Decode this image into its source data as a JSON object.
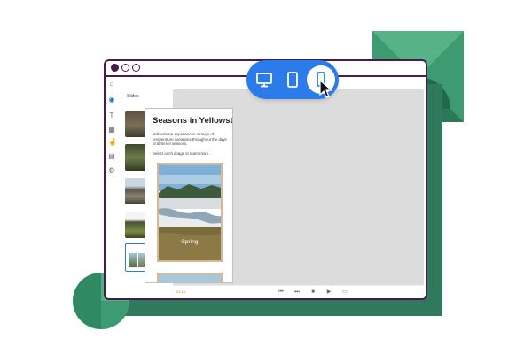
{
  "window": {
    "panel_label": "Slides"
  },
  "rail_icons": [
    "home-icon",
    "slides-icon",
    "text-icon",
    "media-icon",
    "interactions-icon",
    "components-icon",
    "settings-icon"
  ],
  "device_toggle": {
    "options": [
      "desktop",
      "tablet",
      "phone"
    ],
    "selected": "phone"
  },
  "slide": {
    "title": "Seasons in Yellowstone",
    "body": "Yellowstone experiences a range of temperature variations throughout the days of different seasons.",
    "hint": "Select each image to learn more.",
    "image_label": "Spring"
  },
  "playbar": {
    "time": "01:18"
  },
  "colors": {
    "window_border": "#4a1b48",
    "accent": "#2b7bea",
    "deco_green": "#2f7a5c"
  }
}
